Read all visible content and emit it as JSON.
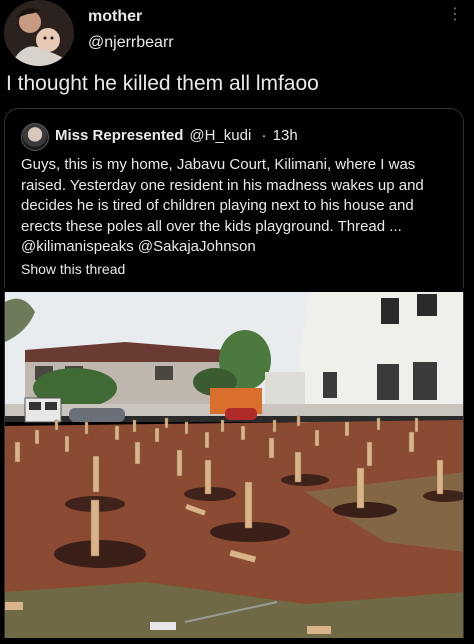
{
  "author": {
    "display_name": "mother",
    "handle": "@njerrbearr",
    "avatar": "profile-photo"
  },
  "tweet": {
    "text": "I thought he killed them all lmfaoo"
  },
  "quoted_tweet": {
    "display_name": "Miss Represented",
    "handle": "@H_kudi",
    "separator": "·",
    "time": "13h",
    "body_lines": [
      "Guys, this is my home, Jabavu Court, Kilimani, where I was",
      "raised. Yesterday one resident in his madness wakes up and",
      "decides he is tired of children playing next to his house and",
      "erects these poles all over the kids playground. Thread ...",
      "@kilimanispeaks @SakajaJohnson"
    ],
    "show_thread_label": "Show this thread"
  },
  "icons": {
    "more": "more-vertical-icon"
  },
  "colors": {
    "background": "#000000",
    "text": "#e7e9ea",
    "border": "#2f3336",
    "soil": "#8b4a32"
  }
}
